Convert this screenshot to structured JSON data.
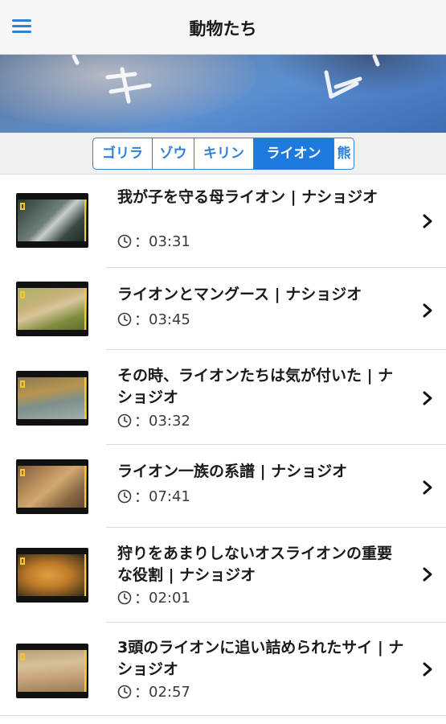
{
  "nav": {
    "title": "動物たち",
    "menu_icon": "hamburger-menu-icon"
  },
  "segments": [
    {
      "label": "ゴリラ",
      "active": false
    },
    {
      "label": "ゾウ",
      "active": false
    },
    {
      "label": "キリン",
      "active": false
    },
    {
      "label": "ライオン",
      "active": true
    },
    {
      "label": "熊",
      "active": false
    }
  ],
  "videos": [
    {
      "title": "我が子を守る母ライオン | ナショジオ",
      "duration": "03:31"
    },
    {
      "title": "ライオンとマングース | ナショジオ",
      "duration": "03:45"
    },
    {
      "title": "その時、ライオンたちは気が付いた | ナショジオ",
      "duration": "03:32"
    },
    {
      "title": "ライオン一族の系譜 | ナショジオ",
      "duration": "07:41"
    },
    {
      "title": "狩りをあまりしないオスライオンの重要な役割 | ナショジオ",
      "duration": "02:01"
    },
    {
      "title": "3頭のライオンに追い詰められたサイ | ナショジオ",
      "duration": "02:57"
    }
  ],
  "duration_prefix": "：",
  "colors": {
    "accent": "#1f7ae0",
    "logo_yellow": "#f6c82d"
  }
}
